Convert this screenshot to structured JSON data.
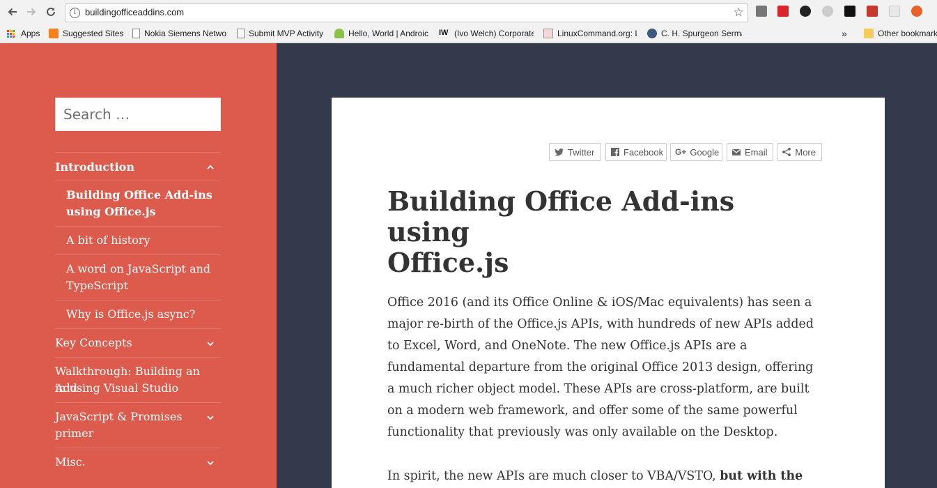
{
  "browser": {
    "url": "buildingofficeaddins.com",
    "bookmarks": [
      {
        "label": "Apps",
        "icon": "apps-grid-icon"
      },
      {
        "label": "Suggested Sites",
        "icon": "suggested-sites-icon"
      },
      {
        "label": "Nokia Siemens Netwo",
        "icon": "page-icon"
      },
      {
        "label": "Submit MVP Activity",
        "icon": "page-icon"
      },
      {
        "label": "Hello, World | Androic",
        "icon": "android-icon"
      },
      {
        "label": "(Ivo Welch) Corporate",
        "icon": "iw-icon"
      },
      {
        "label": "LinuxCommand.org: L",
        "icon": "linuxcommand-icon"
      },
      {
        "label": "C. H. Spurgeon Serma",
        "icon": "spurgeon-icon"
      }
    ],
    "overflow": "»",
    "other_bookmarks": "Other bookmarks"
  },
  "sidebar": {
    "search_placeholder": "Search …",
    "nav": {
      "introduction": "Introduction",
      "sub_building_1": "Building Office Add-ins",
      "sub_building_2": "using Office.js",
      "sub_history": "A bit of history",
      "sub_word_1": "A word on JavaScript and",
      "sub_word_2": "TypeScript",
      "sub_async": "Why is Office.js async?",
      "key_concepts": "Key Concepts",
      "walkthrough_1": "Walkthrough: Building an Add-",
      "walkthrough_2": "in using Visual Studio",
      "promises_1": "JavaScript & Promises",
      "promises_2": "primer",
      "misc": "Misc."
    }
  },
  "article": {
    "share": {
      "twitter": "Twitter",
      "facebook": "Facebook",
      "google": "Google",
      "email": "Email",
      "more": "More"
    },
    "title_line1": "Building Office Add-ins using",
    "title_line2": "Office.js",
    "p1": [
      "Office 2016 (and its Office Online & iOS/Mac equivalents) has seen a",
      "major re-birth of the Office.js APIs, with hundreds of new APIs added",
      "to Excel, Word, and OneNote. The new Office.js APIs are a",
      "fundamental departure from the original Office 2013 design, offering",
      "a much richer object model.  These APIs are cross-platform, are built",
      "on a modern web framework, and offer some of the same powerful",
      "functionality that previously was only available on the Desktop."
    ],
    "p2_normal": "In spirit, the new APIs are much closer to VBA/VSTO, ",
    "p2_bold": "but with the"
  },
  "colors": {
    "sidebar": "#dc5b4d",
    "main_background": "#333a4c",
    "text": "#333333"
  }
}
